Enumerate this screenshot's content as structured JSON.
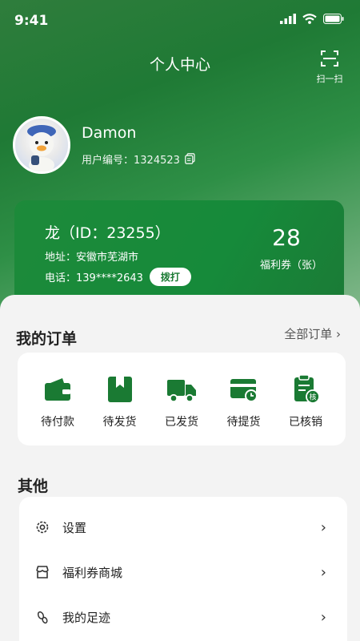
{
  "status_bar": {
    "time": "9:41"
  },
  "header": {
    "title": "个人中心",
    "scan_label": "扫一扫"
  },
  "profile": {
    "name": "Damon",
    "user_id_label": "用户编号：1324523"
  },
  "member_card": {
    "name_line": "龙（ID：23255）",
    "address": "地址：安徽市芜湖市",
    "phone": "电话：139****2643",
    "call_button": "拨打",
    "coupon_count": "28",
    "coupon_label": "福利券（张）"
  },
  "orders": {
    "title": "我的订单",
    "all_link": "全部订单",
    "items": [
      {
        "label": "待付款",
        "icon": "wallet-icon"
      },
      {
        "label": "待发货",
        "icon": "package-icon"
      },
      {
        "label": "已发货",
        "icon": "truck-icon"
      },
      {
        "label": "待提货",
        "icon": "pickup-card-icon"
      },
      {
        "label": "已核销",
        "icon": "verified-clipboard-icon"
      }
    ]
  },
  "other": {
    "title": "其他",
    "items": [
      {
        "label": "设置",
        "icon": "gear-icon"
      },
      {
        "label": "福利券商城",
        "icon": "store-icon"
      },
      {
        "label": "我的足迹",
        "icon": "footprint-icon"
      }
    ]
  },
  "colors": {
    "brand": "#1a7a33",
    "accent": "#168a3a"
  }
}
